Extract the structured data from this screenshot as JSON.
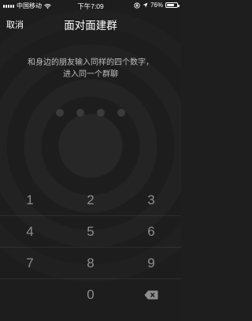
{
  "status_bar": {
    "carrier": "中国移动",
    "time": "下午7:09",
    "battery": "76%",
    "battery_level": 0.76
  },
  "nav": {
    "cancel_label": "取消",
    "title": "面对面建群"
  },
  "instruction": {
    "line1": "和身边的朋友输入同样的四个数字，",
    "line2": "进入同一个群聊"
  },
  "code_length": 4,
  "keypad": {
    "rows": [
      [
        "1",
        "2",
        "3"
      ],
      [
        "4",
        "5",
        "6"
      ],
      [
        "7",
        "8",
        "9"
      ],
      [
        "",
        "0",
        "delete"
      ]
    ]
  },
  "colors": {
    "background": "#1e1e1e",
    "key_text": "#8e8e8e",
    "dot": "#3b3b3b"
  }
}
